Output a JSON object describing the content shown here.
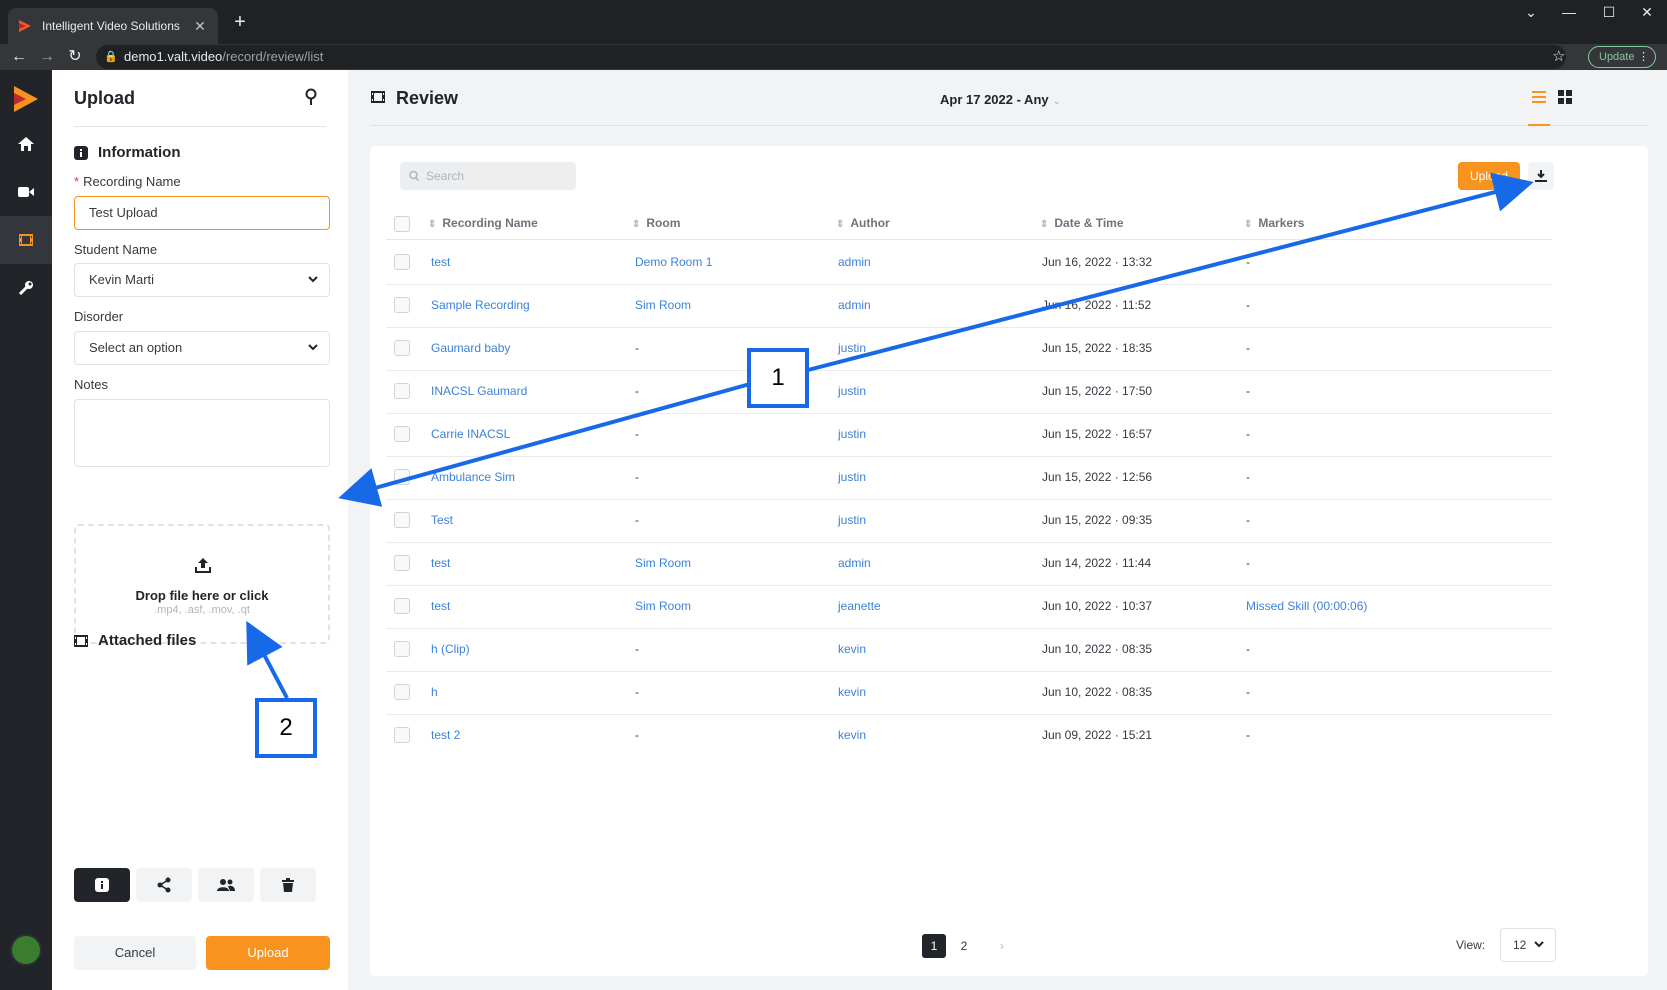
{
  "browser": {
    "tab_title": "Intelligent Video Solutions",
    "url_host": "demo1.valt.video",
    "url_path": "/record/review/list",
    "update_label": "Update"
  },
  "sidebar": {
    "title": "Upload",
    "info_heading": "Information",
    "recording_name_label": "Recording Name",
    "recording_name_value": "Test Upload",
    "student_name_label": "Student Name",
    "student_name_value": "Kevin Marti",
    "disorder_label": "Disorder",
    "disorder_value": "Select an option",
    "notes_label": "Notes",
    "drop_title": "Drop file here or click",
    "drop_formats": ".mp4, .asf, .mov, .qt",
    "attached_heading": "Attached files",
    "cancel_label": "Cancel",
    "upload_label": "Upload"
  },
  "main": {
    "title": "Review",
    "date_filter": "Apr 17 2022 - Any",
    "search_placeholder": "Search",
    "upload_label": "Upload",
    "columns": [
      "Recording Name",
      "Room",
      "Author",
      "Date & Time",
      "Markers"
    ],
    "rows": [
      {
        "name": "test",
        "room": "Demo Room 1",
        "author": "admin",
        "datetime": "Jun 16, 2022 · 13:32",
        "markers": "-"
      },
      {
        "name": "Sample Recording",
        "room": "Sim Room",
        "author": "admin",
        "datetime": "Jun 16, 2022 · 11:52",
        "markers": "-"
      },
      {
        "name": "Gaumard baby",
        "room": "-",
        "author": "justin",
        "datetime": "Jun 15, 2022 · 18:35",
        "markers": "-"
      },
      {
        "name": "INACSL Gaumard",
        "room": "-",
        "author": "justin",
        "datetime": "Jun 15, 2022 · 17:50",
        "markers": "-"
      },
      {
        "name": "Carrie INACSL",
        "room": "-",
        "author": "justin",
        "datetime": "Jun 15, 2022 · 16:57",
        "markers": "-"
      },
      {
        "name": "Ambulance Sim",
        "room": "-",
        "author": "justin",
        "datetime": "Jun 15, 2022 · 12:56",
        "markers": "-"
      },
      {
        "name": "Test",
        "room": "-",
        "author": "justin",
        "datetime": "Jun 15, 2022 · 09:35",
        "markers": "-"
      },
      {
        "name": "test",
        "room": "Sim Room",
        "author": "admin",
        "datetime": "Jun 14, 2022 · 11:44",
        "markers": "-"
      },
      {
        "name": "test",
        "room": "Sim Room",
        "author": "jeanette",
        "datetime": "Jun 10, 2022 · 10:37",
        "markers": "Missed Skill (00:00:06)"
      },
      {
        "name": "h (Clip)",
        "room": "-",
        "author": "kevin",
        "datetime": "Jun 10, 2022 · 08:35",
        "markers": "-"
      },
      {
        "name": "h",
        "room": "-",
        "author": "kevin",
        "datetime": "Jun 10, 2022 · 08:35",
        "markers": "-"
      },
      {
        "name": "test 2",
        "room": "-",
        "author": "kevin",
        "datetime": "Jun 09, 2022 · 15:21",
        "markers": "-"
      }
    ],
    "pagination": {
      "page_1": "1",
      "page_2": "2",
      "next": "›"
    },
    "view_label": "View:",
    "view_value": "12"
  },
  "annotations": {
    "callout_1": "1",
    "callout_2": "2"
  },
  "colors": {
    "accent": "#f7931e",
    "link": "#3b82d9",
    "annotation": "#1769e8"
  }
}
